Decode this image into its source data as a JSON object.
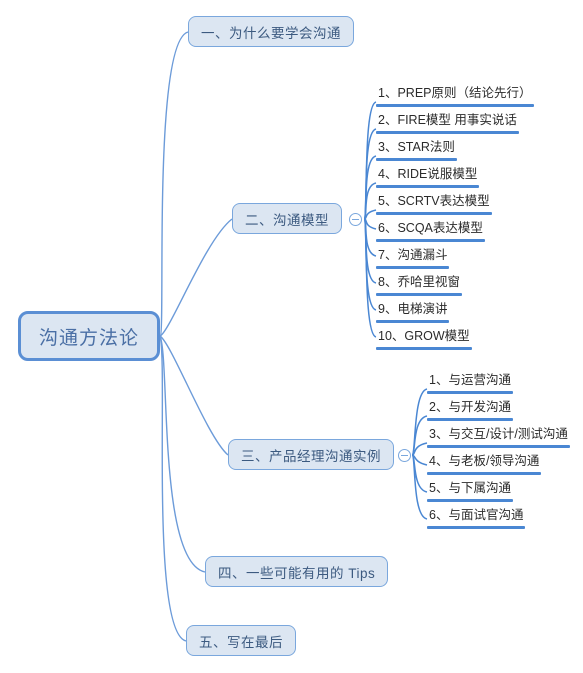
{
  "document": {
    "title": "沟通方法论",
    "type": "mindmap"
  },
  "root": {
    "label": "沟通方法论",
    "fill": "#dce6f2",
    "border": "#5b8fd4",
    "text_color": "#4a6fa5"
  },
  "theme": {
    "connector_color": "#6c9bd9",
    "underline_color": "#4a87d3",
    "node_fill": "#dce6f2",
    "node_border": "#7aa7dd",
    "background": "#ffffff"
  },
  "branches": [
    {
      "id": "branch-1",
      "label": "一、为什么要学会沟通",
      "has_toggle": false,
      "children": []
    },
    {
      "id": "branch-2",
      "label": "二、沟通模型",
      "has_toggle": true,
      "toggle_state": "expanded",
      "toggle_icon": "minus-circle-icon",
      "children": [
        {
          "label": "1、PREP原则（结论先行）"
        },
        {
          "label": "2、FIRE模型 用事实说话"
        },
        {
          "label": "3、STAR法则"
        },
        {
          "label": "4、RIDE说服模型"
        },
        {
          "label": "5、SCRTV表达模型"
        },
        {
          "label": "6、SCQA表达模型"
        },
        {
          "label": "7、沟通漏斗"
        },
        {
          "label": "8、乔哈里视窗"
        },
        {
          "label": "9、电梯演讲"
        },
        {
          "label": "10、GROW模型"
        }
      ]
    },
    {
      "id": "branch-3",
      "label": "三、产品经理沟通实例",
      "has_toggle": true,
      "toggle_state": "expanded",
      "toggle_icon": "minus-circle-icon",
      "children": [
        {
          "label": "1、与运营沟通"
        },
        {
          "label": "2、与开发沟通"
        },
        {
          "label": "3、与交互/设计/测试沟通"
        },
        {
          "label": "4、与老板/领导沟通"
        },
        {
          "label": "5、与下属沟通"
        },
        {
          "label": "6、与面试官沟通"
        }
      ]
    },
    {
      "id": "branch-4",
      "label": "四、一些可能有用的 Tips",
      "has_toggle": false,
      "children": []
    },
    {
      "id": "branch-5",
      "label": "五、写在最后",
      "has_toggle": false,
      "children": []
    }
  ]
}
